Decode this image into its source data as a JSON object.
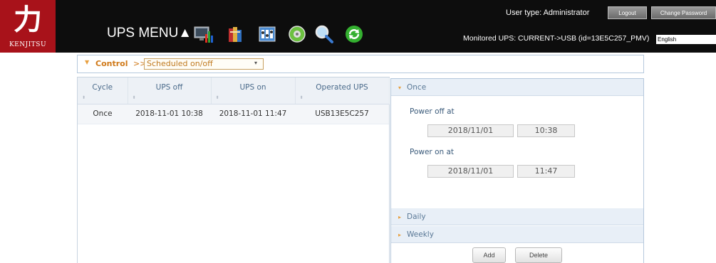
{
  "header": {
    "logo_kanji": "力",
    "logo_brand": "KENJITSU",
    "menu_title": "UPS MENU▲",
    "user_type": "User type: Administrator",
    "logout_label": "Logout",
    "change_password_label": "Change Password",
    "monitored_ups": "Monitored UPS: CURRENT->USB (id=13E5C257_PMV)",
    "language": "English",
    "toolbar_icons": [
      "monitor-chart-icon",
      "books-icon",
      "settings-panel-icon",
      "disc-icon",
      "magnifier-icon",
      "refresh-icon"
    ]
  },
  "control": {
    "label": "Control",
    "separator": ">>",
    "selected": "Scheduled on/off"
  },
  "table": {
    "columns": [
      "Cycle",
      "UPS off",
      "UPS on",
      "Operated UPS"
    ],
    "rows": [
      [
        "Once",
        "2018-11-01 10:38",
        "2018-11-01 11:47",
        "USB13E5C257"
      ]
    ]
  },
  "panel": {
    "once_label": "Once",
    "power_off_label": "Power off at",
    "power_off_date": "2018/11/01",
    "power_off_time": "10:38",
    "power_on_label": "Power on at",
    "power_on_date": "2018/11/01",
    "power_on_time": "11:47",
    "daily_label": "Daily",
    "weekly_label": "Weekly",
    "add_label": "Add",
    "delete_label": "Delete"
  }
}
